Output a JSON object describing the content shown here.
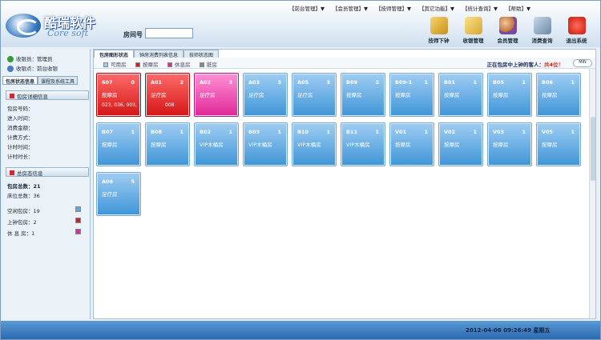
{
  "header": {
    "logo_cn": "酷瑞软件",
    "logo_en": "Core soft",
    "room_label": "房间号",
    "room_value": "",
    "menus": [
      "【前台管理】▼",
      "【会员管理】▼",
      "【技师管理】▼",
      "【其它功能】▼",
      "【统计查询】▼",
      "【帮助】▼"
    ],
    "tools": [
      {
        "label": "技师下钟",
        "icon": "technician-icon"
      },
      {
        "label": "收银管理",
        "icon": "cashier-icon"
      },
      {
        "label": "会员管理",
        "icon": "member-icon"
      },
      {
        "label": "消费查询",
        "icon": "query-icon"
      },
      {
        "label": "退出系统",
        "icon": "exit-icon"
      }
    ]
  },
  "sidebar": {
    "cashier": "收银员：管理员",
    "cashier_point": "收银点：前台收银",
    "tabs": [
      "包房状态信息",
      "课程及系统工具"
    ],
    "detail_title": "包房详细信息",
    "detail_fields": [
      "包房号码：",
      "进入时间：",
      "消费金额：",
      "计费方式：",
      "计时时间：",
      "计时时长："
    ],
    "total_title": "总房态信息",
    "total_rooms": "包房总数：21",
    "total_beds": "床位总数：36",
    "legend": [
      {
        "label": "空闲包房：19",
        "color": "#5aa8e0"
      },
      {
        "label": "上钟包房：2",
        "color": "#d42020"
      },
      {
        "label": "休 息 房：1",
        "color": "#e02898"
      }
    ]
  },
  "main": {
    "tabs": [
      "包房图形状态",
      "钟房消费列表信息",
      "技师状态图"
    ],
    "legend": [
      {
        "label": "可用房",
        "color": "#9fcdf2"
      },
      {
        "label": "按摩房",
        "color": "#d42020"
      },
      {
        "label": "休息房",
        "color": "#e02898"
      },
      {
        "label": "脏房",
        "color": "#888888"
      }
    ],
    "guest_prefix": "正在包房中上钟的客人：",
    "guest_count": "共4位！",
    "min_label": "MIN",
    "rooms": [
      {
        "code": "607",
        "num": "0",
        "type": "按摩房",
        "state": "busy",
        "extra": "023, 036, 003,",
        "extra2": ""
      },
      {
        "code": "A01",
        "num": "2",
        "type": "足疗房",
        "state": "busy",
        "extra": "",
        "extra2": "008"
      },
      {
        "code": "A02",
        "num": "3",
        "type": "足疗房",
        "state": "rest",
        "extra": "",
        "extra2": ""
      },
      {
        "code": "A03",
        "num": "3",
        "type": "足疗房",
        "state": "free",
        "extra": "",
        "extra2": ""
      },
      {
        "code": "A05",
        "num": "3",
        "type": "足疗房",
        "state": "free",
        "extra": "",
        "extra2": ""
      },
      {
        "code": "B09",
        "num": "2",
        "type": "按摩房",
        "state": "free",
        "extra": "",
        "extra2": ""
      },
      {
        "code": "B09-1",
        "num": "1",
        "type": "按摩房",
        "state": "free",
        "extra": "",
        "extra2": ""
      },
      {
        "code": "B01",
        "num": "1",
        "type": "按摩房",
        "state": "free",
        "extra": "",
        "extra2": ""
      },
      {
        "code": "B05",
        "num": "1",
        "type": "按摩房",
        "state": "free",
        "extra": "",
        "extra2": ""
      },
      {
        "code": "B06",
        "num": "1",
        "type": "按摩房",
        "state": "free",
        "extra": "",
        "extra2": ""
      },
      {
        "code": "B07",
        "num": "1",
        "type": "按摩房",
        "state": "free",
        "extra": "",
        "extra2": ""
      },
      {
        "code": "B08",
        "num": "1",
        "type": "按摩房",
        "state": "free",
        "extra": "",
        "extra2": ""
      },
      {
        "code": "B02",
        "num": "1",
        "type": "VIP木桶房",
        "state": "free",
        "extra": "",
        "extra2": ""
      },
      {
        "code": "B03",
        "num": "1",
        "type": "VIP木桶房",
        "state": "free",
        "extra": "",
        "extra2": ""
      },
      {
        "code": "B10",
        "num": "1",
        "type": "VIP木桶房",
        "state": "free",
        "extra": "",
        "extra2": ""
      },
      {
        "code": "B11",
        "num": "1",
        "type": "VIP木桶房",
        "state": "free",
        "extra": "",
        "extra2": ""
      },
      {
        "code": "V01",
        "num": "1",
        "type": "按摩房",
        "state": "free",
        "extra": "",
        "extra2": ""
      },
      {
        "code": "V02",
        "num": "1",
        "type": "按摩房",
        "state": "free",
        "extra": "",
        "extra2": ""
      },
      {
        "code": "V03",
        "num": "1",
        "type": "按摩房",
        "state": "free",
        "extra": "",
        "extra2": ""
      },
      {
        "code": "V05",
        "num": "1",
        "type": "按摩房",
        "state": "free",
        "extra": "",
        "extra2": ""
      },
      {
        "code": "A06",
        "num": "5",
        "type": "足疗房",
        "state": "free",
        "extra": "",
        "extra2": ""
      }
    ]
  },
  "status": {
    "datetime": "2012-04-06 09:26:49  星期五"
  }
}
